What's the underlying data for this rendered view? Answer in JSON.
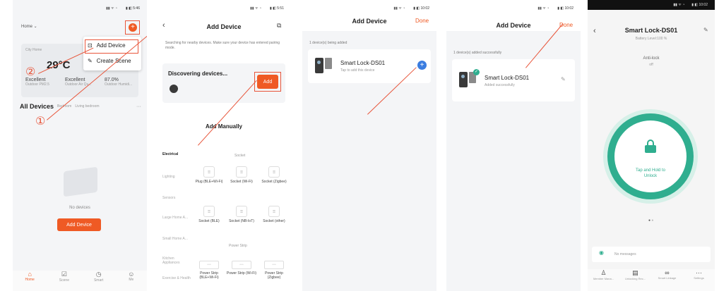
{
  "screen1": {
    "home_label": "Home ⌄",
    "city_label": "City Home",
    "temperature": "29°C",
    "stats": [
      {
        "value": "Excellent",
        "label": "Outdoor PM2.5"
      },
      {
        "value": "Excellent",
        "label": "Outdoor Air Qu..."
      },
      {
        "value": "87.0%",
        "label": "Outdoor Humidi..."
      }
    ],
    "menu": {
      "add_device": "Add Device",
      "create_scene": "Create Scene"
    },
    "all_devices": "All Devices",
    "filters": [
      "Bedroom",
      "Living bedroom"
    ],
    "more": "···",
    "empty_text": "No devices",
    "add_device_button": "Add Device",
    "tabs": [
      "Home",
      "Scene",
      "Smart",
      "Me"
    ],
    "marker1": "①",
    "marker2": "②"
  },
  "screen2": {
    "title": "Add Device",
    "hint": "Searching for nearby devices. Make sure your device has entered pairing mode.",
    "discovering": "Discovering devices...",
    "add_button": "Add",
    "add_manually": "Add Manually",
    "categories": [
      "Electrical",
      "Lighting",
      "Sensors",
      "Large Home A...",
      "Small Home A...",
      "Kitchen Appliances",
      "Exercise & Health"
    ],
    "section_socket": "Socket",
    "section_power_strip": "Power Strip",
    "sockets_row1": [
      "Plug (BLE+Wi-Fi)",
      "Socket (Wi-Fi)",
      "Socket (Zigbee)"
    ],
    "sockets_row2": [
      "Socket (BLE)",
      "Socket (NB-IoT)",
      "Socket (other)"
    ],
    "strips": [
      "Power Strip (BLE+Wi-Fi)",
      "Power Strip (Wi-Fi)",
      "Power Strip (Zigbee)"
    ]
  },
  "screen3": {
    "title": "Add Device",
    "done": "Done",
    "sub": "1 device(s) being added",
    "device_name": "Smart Lock-DS01",
    "device_status": "Tap to add this device"
  },
  "screen4": {
    "title": "Add Device",
    "done": "Done",
    "sub": "1 device(s) added successfully",
    "device_name": "Smart Lock-DS01",
    "device_status": "Added successfully"
  },
  "screen5": {
    "title": "Smart Lock-DS01",
    "battery": "Battery Level:100 %",
    "anti_lock": "Anti-lock",
    "anti_lock_state": "off",
    "unlock_text": "Tap and Hold to Unlock",
    "messages": "No messages",
    "bottom": [
      "Member Mana...",
      "Unlocking Rec...",
      "Smart Linkage",
      "Settings"
    ]
  },
  "colors": {
    "accent": "#ef5a24",
    "lock_green": "#2fae8f",
    "arrow_red": "#e8553a"
  }
}
